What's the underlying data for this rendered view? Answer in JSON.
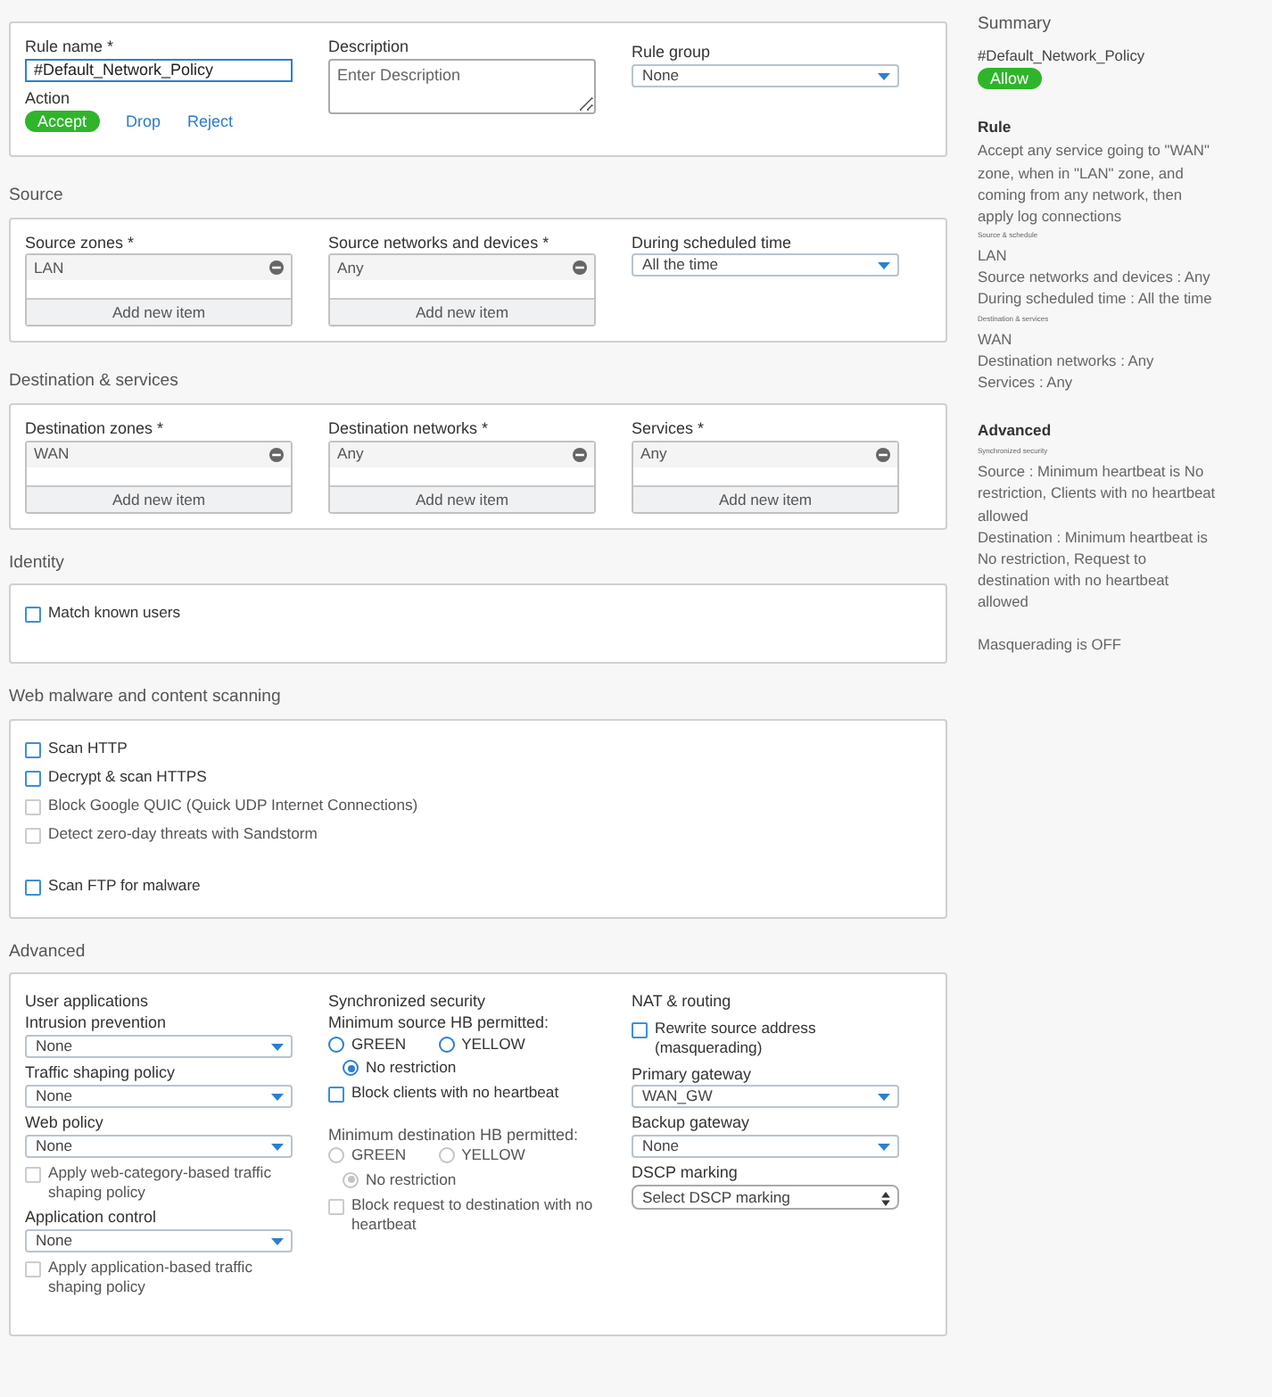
{
  "general": {
    "rule_name": {
      "label": "Rule name *",
      "value": "#Default_Network_Policy"
    },
    "action": {
      "label": "Action",
      "options": [
        {
          "label": "Accept",
          "selected": true
        },
        {
          "label": "Drop",
          "selected": false
        },
        {
          "label": "Reject",
          "selected": false
        }
      ]
    },
    "description": {
      "label": "Description",
      "placeholder": "Enter Description"
    },
    "rule_group": {
      "label": "Rule group",
      "value": "None"
    }
  },
  "sections": [
    {
      "title": "Source",
      "fields": [
        {
          "kind": "list",
          "label": "Source zones *",
          "items": [
            "LAN"
          ],
          "add": "Add new item"
        },
        {
          "kind": "list",
          "label": "Source networks and devices *",
          "items": [
            "Any"
          ],
          "add": "Add new item"
        },
        {
          "kind": "select",
          "label": "During scheduled time",
          "value": "All the time"
        }
      ]
    },
    {
      "title": "Destination & services",
      "fields": [
        {
          "kind": "list",
          "label": "Destination zones *",
          "items": [
            "WAN"
          ],
          "add": "Add new item"
        },
        {
          "kind": "list",
          "label": "Destination networks *",
          "items": [
            "Any"
          ],
          "add": "Add new item"
        },
        {
          "kind": "list",
          "label": "Services *",
          "items": [
            "Any"
          ],
          "add": "Add new item"
        }
      ]
    }
  ],
  "identity": {
    "title": "Identity",
    "checkboxes": [
      {
        "label": "Match known users",
        "checked": false,
        "disabled": false
      }
    ]
  },
  "web_scanning": {
    "title": "Web malware and content scanning",
    "checkboxes": [
      {
        "label": "Scan HTTP",
        "checked": false,
        "disabled": false
      },
      {
        "label": "Decrypt & scan HTTPS",
        "checked": false,
        "disabled": false
      },
      {
        "label": "Block Google QUIC (Quick UDP Internet Connections)",
        "checked": false,
        "disabled": true
      },
      {
        "label": "Detect zero-day threats with Sandstorm",
        "checked": false,
        "disabled": true
      },
      {
        "label": "Scan FTP for malware",
        "checked": false,
        "disabled": false
      }
    ]
  },
  "advanced": {
    "title": "Advanced",
    "columns": [
      {
        "title": "User applications",
        "items": [
          {
            "kind": "select",
            "label": "Intrusion prevention",
            "value": "None"
          },
          {
            "kind": "select",
            "label": "Traffic shaping policy",
            "value": "None"
          },
          {
            "kind": "select",
            "label": "Web policy",
            "value": "None"
          },
          {
            "kind": "checkbox",
            "label": "Apply web-category-based traffic shaping policy",
            "checked": false,
            "disabled": true
          },
          {
            "kind": "select",
            "label": "Application control",
            "value": "None"
          },
          {
            "kind": "checkbox",
            "label": "Apply application-based traffic shaping policy",
            "checked": false,
            "disabled": true
          }
        ]
      },
      {
        "title": "Synchronized security",
        "items": [
          {
            "kind": "radio-group",
            "label": "Minimum source HB permitted:",
            "disabled": false,
            "options": [
              {
                "label": "GREEN",
                "selected": false
              },
              {
                "label": "YELLOW",
                "selected": false
              },
              {
                "label": "No restriction",
                "selected": true
              }
            ]
          },
          {
            "kind": "checkbox",
            "label": "Block clients with no heartbeat",
            "checked": false,
            "disabled": false
          },
          {
            "kind": "radio-group",
            "label": "Minimum destination HB permitted:",
            "disabled": true,
            "options": [
              {
                "label": "GREEN",
                "selected": false
              },
              {
                "label": "YELLOW",
                "selected": false
              },
              {
                "label": "No restriction",
                "selected": true
              }
            ]
          },
          {
            "kind": "checkbox",
            "label": "Block request to destination with no heartbeat",
            "checked": false,
            "disabled": true
          }
        ]
      },
      {
        "title": "NAT & routing",
        "items": [
          {
            "kind": "checkbox",
            "label": "Rewrite source address (masquerading)",
            "checked": false,
            "disabled": false
          },
          {
            "kind": "select",
            "label": "Primary gateway",
            "value": "WAN_GW"
          },
          {
            "kind": "select",
            "label": "Backup gateway",
            "value": "None"
          },
          {
            "kind": "stepper-select",
            "label": "DSCP marking",
            "value": "Select DSCP marking"
          }
        ]
      }
    ]
  },
  "summary": {
    "title": "Summary",
    "rule_name": "#Default_Network_Policy",
    "badge": "Allow",
    "blocks": [
      {
        "kind": "heading",
        "text": "Rule"
      },
      {
        "kind": "text",
        "text": "Accept any service going to \"WAN\" zone, when in \"LAN\" zone, and coming from any network, then apply log connections"
      },
      {
        "kind": "subheading",
        "text": "Source & schedule"
      },
      {
        "kind": "text",
        "text": "LAN"
      },
      {
        "kind": "text",
        "text": "Source networks and devices : Any"
      },
      {
        "kind": "text",
        "text": "During scheduled time : All the time"
      },
      {
        "kind": "subheading",
        "text": "Destination & services"
      },
      {
        "kind": "text",
        "text": "WAN"
      },
      {
        "kind": "text",
        "text": "Destination networks : Any"
      },
      {
        "kind": "text",
        "text": "Services : Any"
      },
      {
        "kind": "heading",
        "text": "Advanced"
      },
      {
        "kind": "subheading",
        "text": "Synchronized security"
      },
      {
        "kind": "text",
        "text": "Source : Minimum heartbeat is No restriction, Clients with no heartbeat allowed"
      },
      {
        "kind": "text",
        "text": "Destination : Minimum heartbeat is No restriction, Request to destination with no heartbeat allowed"
      },
      {
        "kind": "note",
        "text": "Masquerading is OFF"
      }
    ]
  }
}
